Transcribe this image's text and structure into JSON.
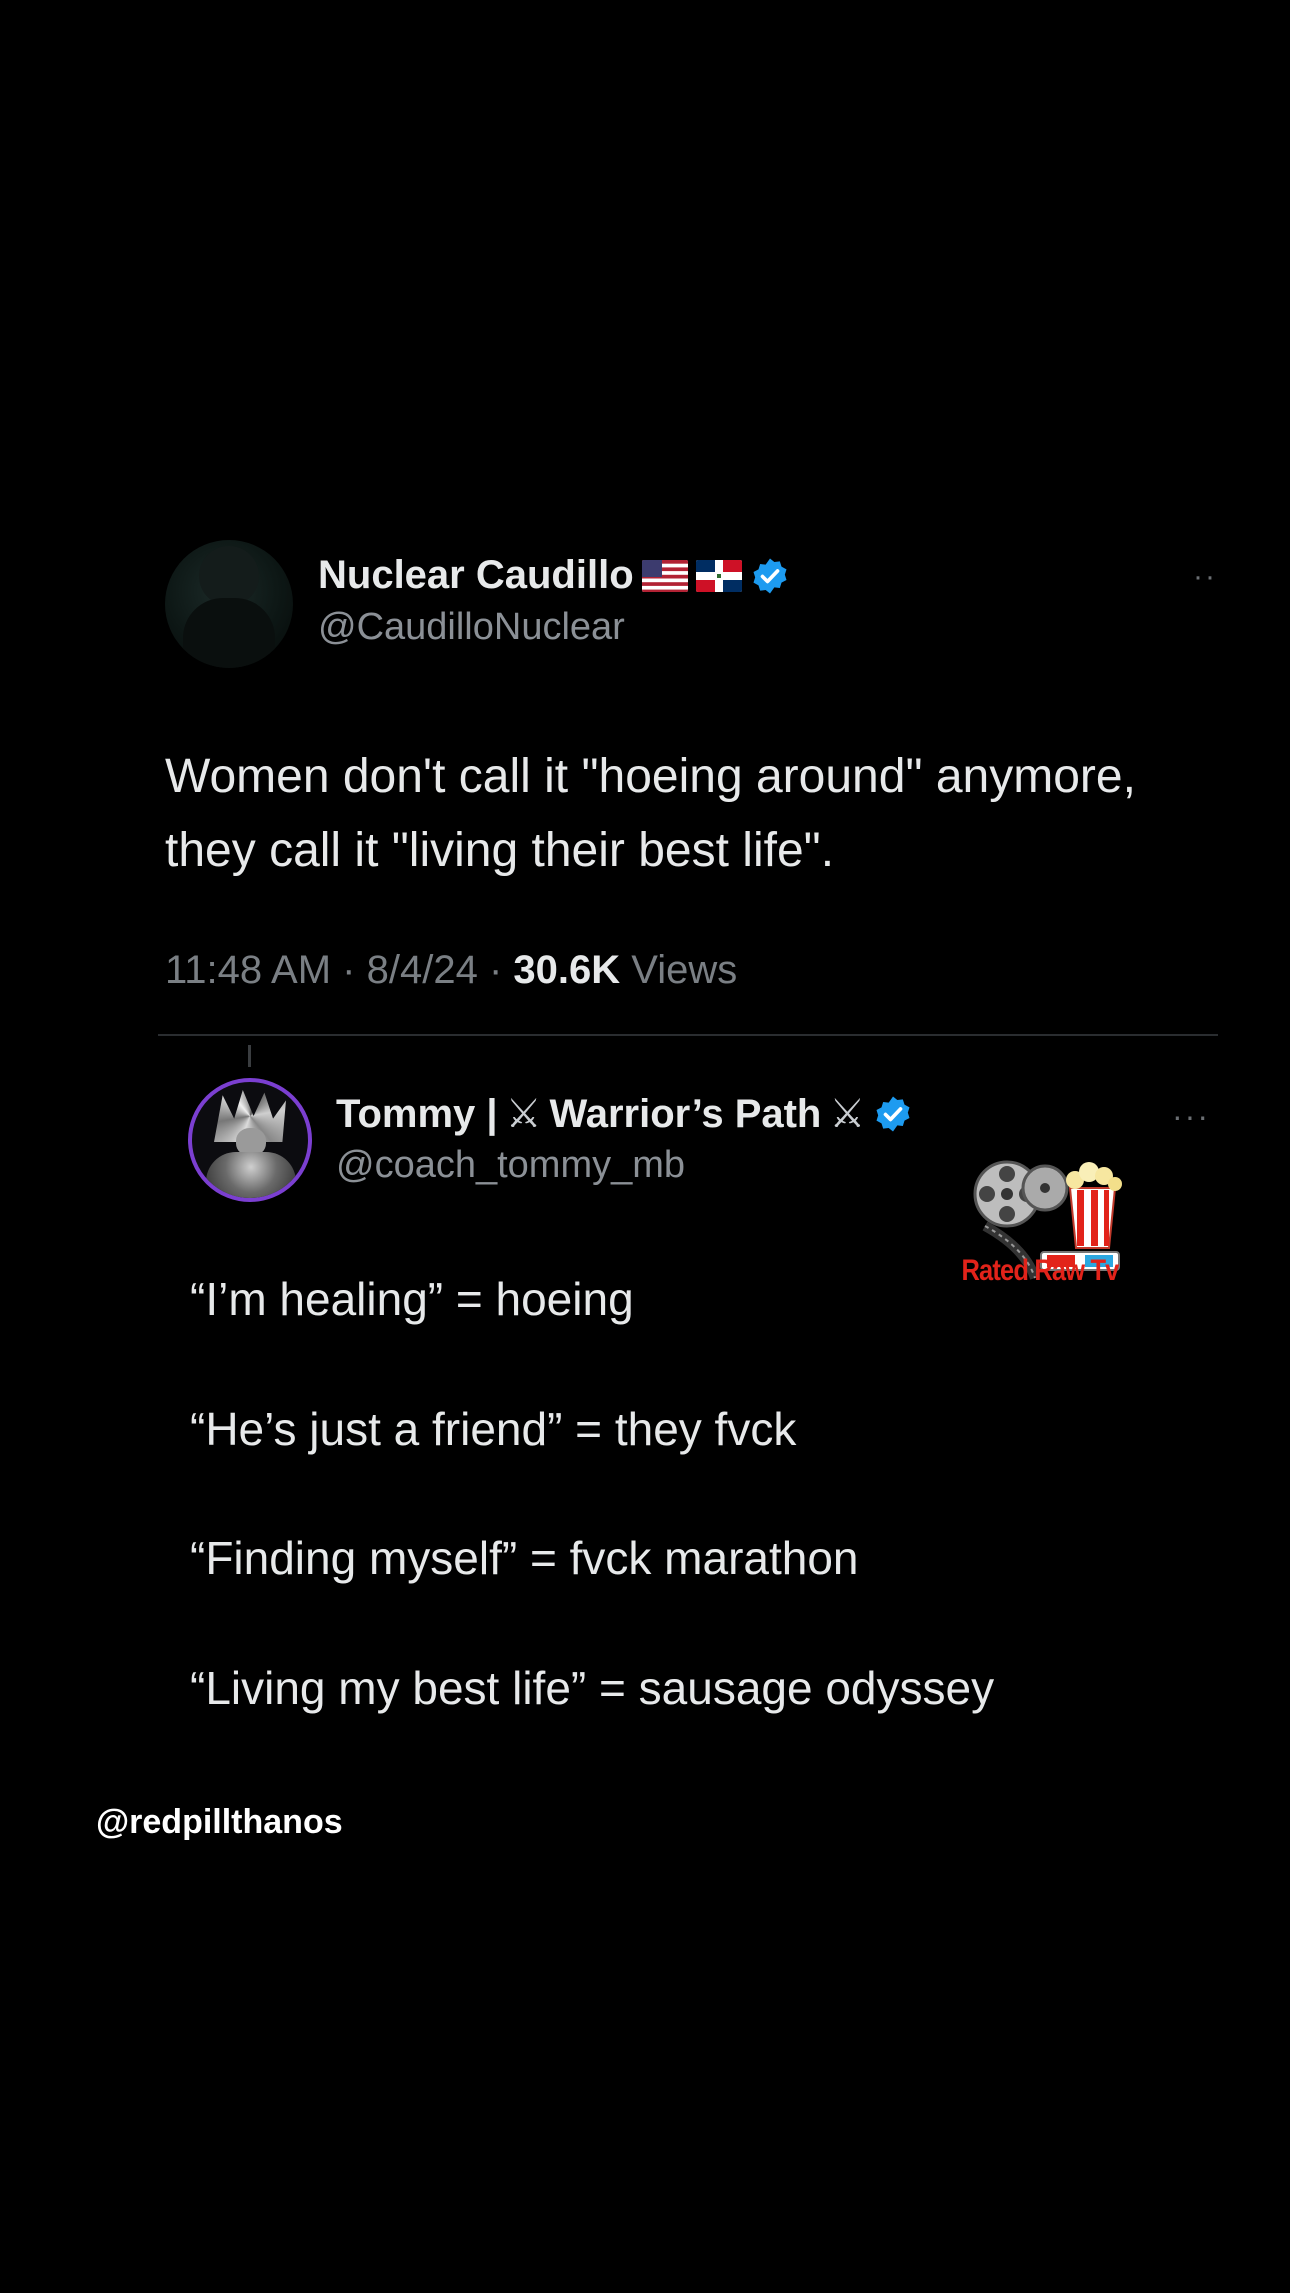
{
  "tweet": {
    "author": {
      "display_name": "Nuclear Caudillo",
      "handle": "@CaudilloNuclear",
      "flags": [
        "us-flag-icon",
        "dominican-republic-flag-icon"
      ],
      "verified": true
    },
    "text_line_1": "Women don't call it \"hoeing around\" anymore,",
    "text_line_2": "they call it \"living their best life\".",
    "time": "11:48 AM",
    "date": "8/4/24",
    "views_count": "30.6K",
    "views_label": "Views",
    "separator": "·",
    "more_glyph": "··"
  },
  "reply": {
    "author": {
      "display_name_prefix": "Tommy |",
      "display_name_main": "Warrior’s Path",
      "handle": "@coach_tommy_mb",
      "verified": true,
      "sword_glyph": "⚔"
    },
    "more_glyph": "···",
    "lines": [
      "“I’m healing” = hoeing",
      "“He’s just a friend” = they fvck",
      "“Finding myself” = fvck marathon",
      "“Living my best life” = sausage odyssey"
    ]
  },
  "logo": {
    "text": "Rated Raw Tv",
    "icon": "film-reel-popcorn-3d-glasses-icon"
  },
  "watermark": "@redpillthanos",
  "colors": {
    "background": "#000000",
    "text_primary": "#e7e9ea",
    "text_secondary": "#8b9096",
    "verified_blue": "#1d9bf0",
    "logo_red": "#e2231a",
    "avatar_ring": "#7b3fd1"
  }
}
